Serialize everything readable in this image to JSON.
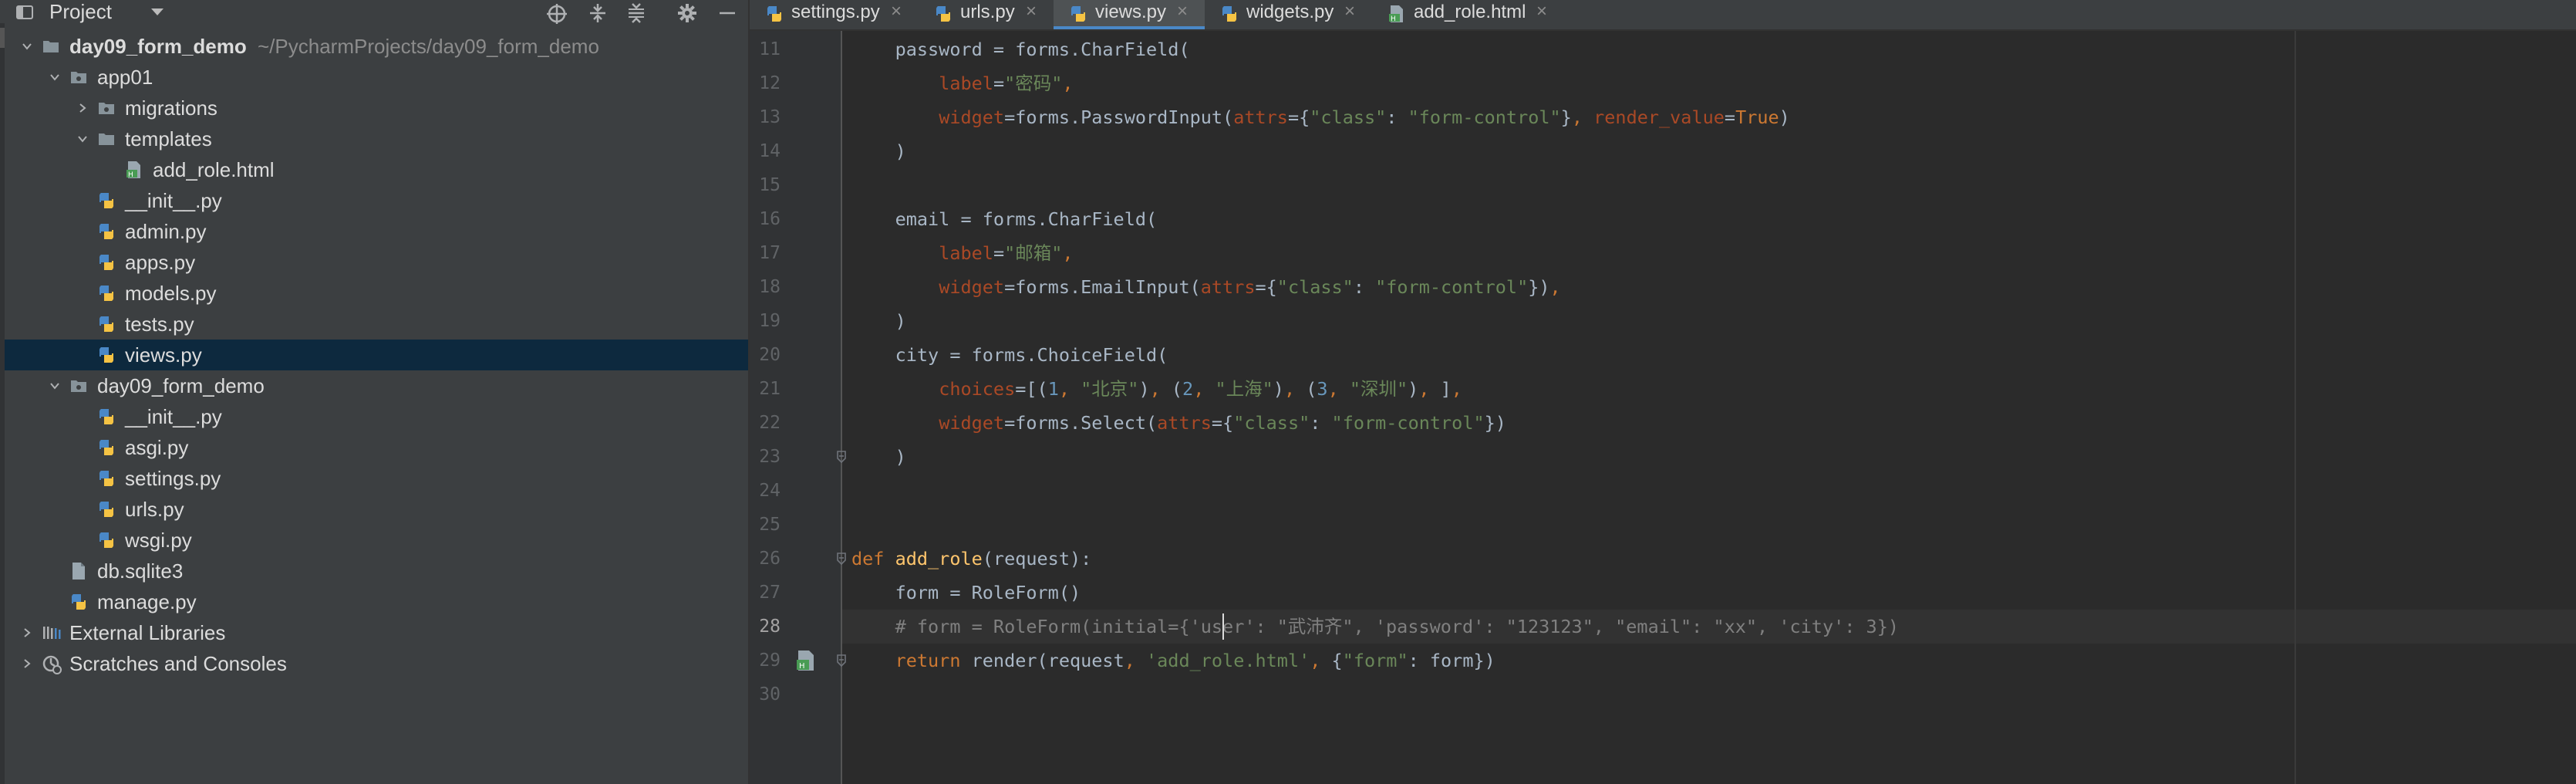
{
  "project_panel": {
    "title": "Project",
    "toolbar_icons": [
      "locate-icon",
      "expand-all-icon",
      "collapse-all-icon",
      "gear-icon",
      "minimize-icon"
    ],
    "tree": [
      {
        "label": "day09_form_demo",
        "path": "~/PycharmProjects/day09_form_demo",
        "icon": "folder-icon",
        "depth": 0,
        "arrow": "down",
        "bold": true
      },
      {
        "label": "app01",
        "icon": "package-icon",
        "depth": 1,
        "arrow": "down"
      },
      {
        "label": "migrations",
        "icon": "package-icon",
        "depth": 2,
        "arrow": "right"
      },
      {
        "label": "templates",
        "icon": "folder-icon",
        "depth": 2,
        "arrow": "down"
      },
      {
        "label": "add_role.html",
        "icon": "html-file-icon",
        "depth": 3
      },
      {
        "label": "__init__.py",
        "icon": "python-file-icon",
        "depth": 2
      },
      {
        "label": "admin.py",
        "icon": "python-file-icon",
        "depth": 2
      },
      {
        "label": "apps.py",
        "icon": "python-file-icon",
        "depth": 2
      },
      {
        "label": "models.py",
        "icon": "python-file-icon",
        "depth": 2
      },
      {
        "label": "tests.py",
        "icon": "python-file-icon",
        "depth": 2
      },
      {
        "label": "views.py",
        "icon": "python-file-icon",
        "depth": 2,
        "selected": true
      },
      {
        "label": "day09_form_demo",
        "icon": "package-icon",
        "depth": 1,
        "arrow": "down"
      },
      {
        "label": "__init__.py",
        "icon": "python-file-icon",
        "depth": 2
      },
      {
        "label": "asgi.py",
        "icon": "python-file-icon",
        "depth": 2
      },
      {
        "label": "settings.py",
        "icon": "python-file-icon",
        "depth": 2
      },
      {
        "label": "urls.py",
        "icon": "python-file-icon",
        "depth": 2
      },
      {
        "label": "wsgi.py",
        "icon": "python-file-icon",
        "depth": 2
      },
      {
        "label": "db.sqlite3",
        "icon": "database-file-icon",
        "depth": 1
      },
      {
        "label": "manage.py",
        "icon": "python-file-icon",
        "depth": 1
      },
      {
        "label": "External Libraries",
        "icon": "library-icon",
        "depth": 0,
        "arrow": "right"
      },
      {
        "label": "Scratches and Consoles",
        "icon": "scratches-icon",
        "depth": 0,
        "arrow": "right"
      }
    ]
  },
  "tabs": [
    {
      "label": "settings.py",
      "icon": "python-file-icon",
      "active": false
    },
    {
      "label": "urls.py",
      "icon": "python-file-icon",
      "active": false
    },
    {
      "label": "views.py",
      "icon": "python-file-icon",
      "active": true
    },
    {
      "label": "widgets.py",
      "icon": "python-file-icon",
      "active": false
    },
    {
      "label": "add_role.html",
      "icon": "html-file-icon",
      "active": false
    }
  ],
  "tab_close_glyph": "×",
  "editor": {
    "current_line": 28,
    "lines": [
      {
        "n": "11",
        "indent": 4,
        "tokens": [
          [
            "plain",
            "password = forms.CharField("
          ]
        ]
      },
      {
        "n": "12",
        "indent": 8,
        "tokens": [
          [
            "param",
            "label"
          ],
          [
            "plain",
            "="
          ],
          [
            "str",
            "\"密码\""
          ],
          [
            "kw",
            ","
          ]
        ]
      },
      {
        "n": "13",
        "indent": 8,
        "tokens": [
          [
            "param",
            "widget"
          ],
          [
            "plain",
            "=forms.PasswordInput("
          ],
          [
            "param",
            "attrs"
          ],
          [
            "plain",
            "={"
          ],
          [
            "str",
            "\"class\""
          ],
          [
            "plain",
            ": "
          ],
          [
            "str",
            "\"form-control\""
          ],
          [
            "plain",
            "}"
          ],
          [
            "kw",
            ", "
          ],
          [
            "param",
            "render_value"
          ],
          [
            "plain",
            "="
          ],
          [
            "kw",
            "True"
          ],
          [
            "plain",
            ")"
          ]
        ]
      },
      {
        "n": "14",
        "indent": 4,
        "tokens": [
          [
            "plain",
            ")"
          ]
        ]
      },
      {
        "n": "15",
        "indent": 0,
        "tokens": []
      },
      {
        "n": "16",
        "indent": 4,
        "tokens": [
          [
            "plain",
            "email = forms.CharField("
          ]
        ]
      },
      {
        "n": "17",
        "indent": 8,
        "tokens": [
          [
            "param",
            "label"
          ],
          [
            "plain",
            "="
          ],
          [
            "str",
            "\"邮箱\""
          ],
          [
            "kw",
            ","
          ]
        ]
      },
      {
        "n": "18",
        "indent": 8,
        "tokens": [
          [
            "param",
            "widget"
          ],
          [
            "plain",
            "=forms.EmailInput("
          ],
          [
            "param",
            "attrs"
          ],
          [
            "plain",
            "={"
          ],
          [
            "str",
            "\"class\""
          ],
          [
            "plain",
            ": "
          ],
          [
            "str",
            "\"form-control\""
          ],
          [
            "plain",
            "})"
          ],
          [
            "kw",
            ","
          ]
        ]
      },
      {
        "n": "19",
        "indent": 4,
        "tokens": [
          [
            "plain",
            ")"
          ]
        ]
      },
      {
        "n": "20",
        "indent": 4,
        "tokens": [
          [
            "plain",
            "city = forms.ChoiceField("
          ]
        ]
      },
      {
        "n": "21",
        "indent": 8,
        "tokens": [
          [
            "param",
            "choices"
          ],
          [
            "plain",
            "=[("
          ],
          [
            "num",
            "1"
          ],
          [
            "kw",
            ", "
          ],
          [
            "str",
            "\"北京\""
          ],
          [
            "plain",
            ")"
          ],
          [
            "kw",
            ", "
          ],
          [
            "plain",
            "("
          ],
          [
            "num",
            "2"
          ],
          [
            "kw",
            ", "
          ],
          [
            "str",
            "\"上海\""
          ],
          [
            "plain",
            ")"
          ],
          [
            "kw",
            ", "
          ],
          [
            "plain",
            "("
          ],
          [
            "num",
            "3"
          ],
          [
            "kw",
            ", "
          ],
          [
            "str",
            "\"深圳\""
          ],
          [
            "plain",
            ")"
          ],
          [
            "kw",
            ", "
          ],
          [
            "plain",
            "]"
          ],
          [
            "kw",
            ","
          ]
        ]
      },
      {
        "n": "22",
        "indent": 8,
        "tokens": [
          [
            "param",
            "widget"
          ],
          [
            "plain",
            "=forms.Select("
          ],
          [
            "param",
            "attrs"
          ],
          [
            "plain",
            "={"
          ],
          [
            "str",
            "\"class\""
          ],
          [
            "plain",
            ": "
          ],
          [
            "str",
            "\"form-control\""
          ],
          [
            "plain",
            "})"
          ]
        ]
      },
      {
        "n": "23",
        "indent": 4,
        "tokens": [
          [
            "plain",
            ")"
          ]
        ]
      },
      {
        "n": "24",
        "indent": 0,
        "tokens": []
      },
      {
        "n": "25",
        "indent": 0,
        "tokens": []
      },
      {
        "n": "26",
        "indent": 0,
        "tokens": [
          [
            "kw",
            "def "
          ],
          [
            "fn",
            "add_role"
          ],
          [
            "plain",
            "(request):"
          ]
        ]
      },
      {
        "n": "27",
        "indent": 4,
        "tokens": [
          [
            "plain",
            "form = RoleForm()"
          ]
        ]
      },
      {
        "n": "28",
        "indent": 4,
        "tokens": [
          [
            "comment",
            "# form = RoleForm(initial={'user': \"武沛齐\", 'password': \"123123\", \"email\": \"xx\", 'city': 3})"
          ]
        ]
      },
      {
        "n": "29",
        "indent": 4,
        "tokens": [
          [
            "kw",
            "return "
          ],
          [
            "plain",
            "render(request"
          ],
          [
            "kw",
            ", "
          ],
          [
            "str",
            "'add_role.html'"
          ],
          [
            "kw",
            ", "
          ],
          [
            "plain",
            "{"
          ],
          [
            "str",
            "\"form\""
          ],
          [
            "plain",
            ": form})"
          ]
        ]
      },
      {
        "n": "30",
        "indent": 0,
        "tokens": []
      }
    ]
  },
  "colors": {
    "panel_bg": "#3c3f41",
    "editor_bg": "#2b2b2b",
    "selection": "#0d293e",
    "keyword": "#cc7832",
    "string": "#6a8759",
    "number": "#6897bb",
    "param": "#aa4926",
    "function": "#ffc66d",
    "comment": "#808080",
    "active_tab_underline": "#4a88c7"
  }
}
